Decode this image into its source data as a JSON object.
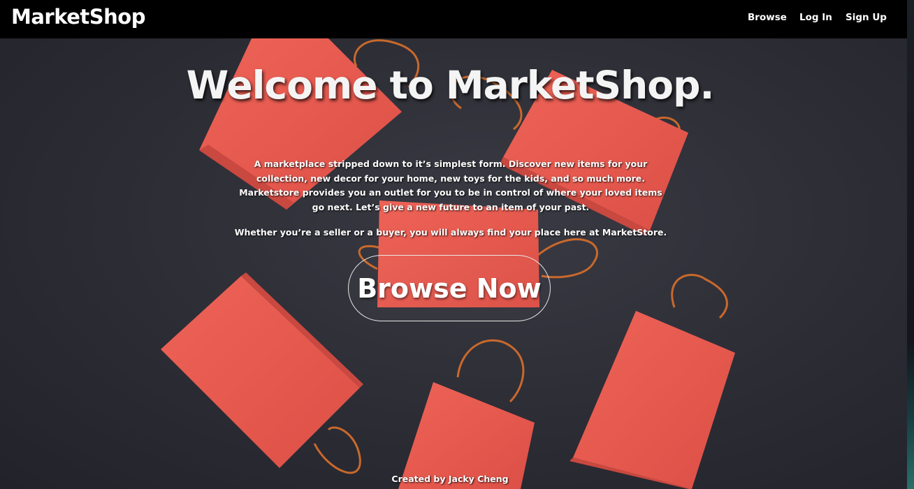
{
  "navbar": {
    "brand": "MarketShop",
    "links": [
      {
        "label": "Browse"
      },
      {
        "label": "Log In"
      },
      {
        "label": "Sign Up"
      }
    ]
  },
  "hero": {
    "title": "Welcome to MarketShop.",
    "description": "A marketplace stripped down to it’s simplest form. Discover new items for your collection, new decor for your home, new toys for the kids, and so much more. Marketstore provides you an outlet for you to be in control of where your loved items go next. Let’s give a new future to an item of your past.",
    "subtext": "Whether you’re a seller or a buyer, you will always find your place here at MarketStore.",
    "cta_label": "Browse Now"
  },
  "footer": {
    "credit": "Created by Jacky Cheng"
  },
  "colors": {
    "navbar_bg": "#000000",
    "hero_bg": "#2c2c34",
    "bag_red": "#e8584e",
    "handle_orange": "#c8692c",
    "text": "#ffffff"
  }
}
